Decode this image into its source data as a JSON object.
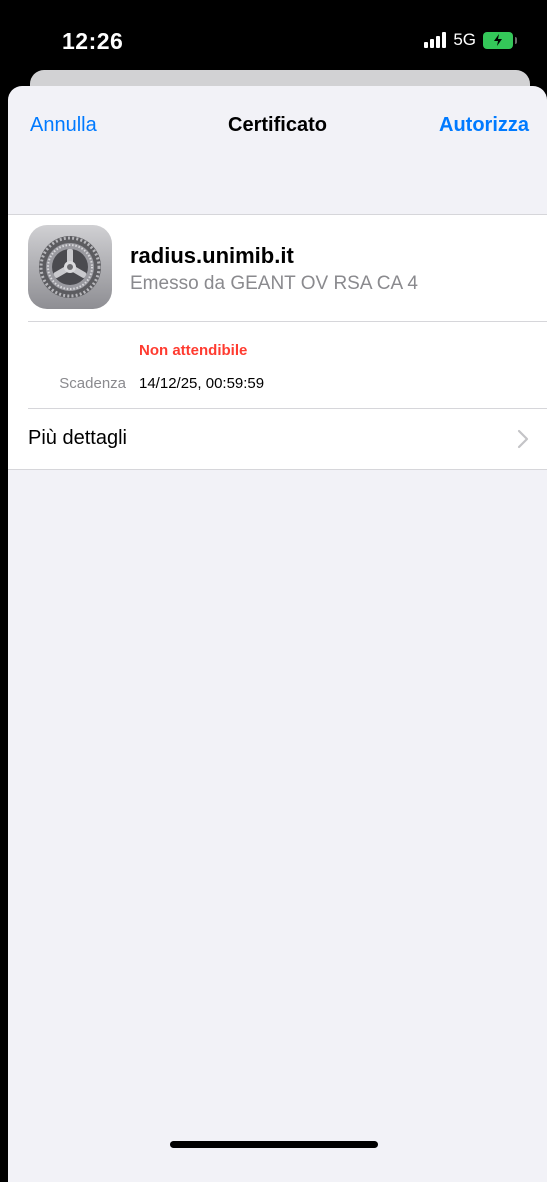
{
  "status_bar": {
    "time": "12:26",
    "network": "5G",
    "signal_icon": "signal-bars-icon",
    "battery_icon": "battery-charging-icon",
    "battery_color": "#34c759"
  },
  "nav": {
    "cancel_label": "Annulla",
    "title": "Certificato",
    "authorize_label": "Autorizza",
    "accent_color": "#007aff"
  },
  "certificate": {
    "icon": "settings-gear-icon",
    "name": "radius.unimib.it",
    "issuer": "Emesso da GEANT OV RSA CA 4",
    "trust_status": "Non attendibile",
    "trust_color": "#ff3b30",
    "expiry_label": "Scadenza",
    "expiry_value": "14/12/25, 00:59:59"
  },
  "more_details": {
    "label": "Più dettagli",
    "icon": "chevron-right-icon"
  }
}
